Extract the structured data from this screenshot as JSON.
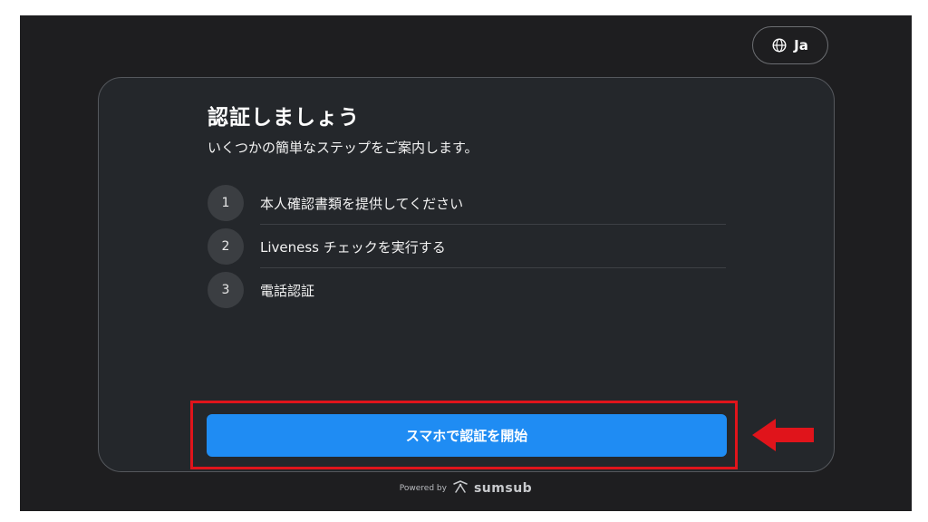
{
  "header": {
    "language_label": "Ja",
    "language_icon": "globe-icon"
  },
  "card": {
    "title": "認証しましょう",
    "subtitle": "いくつかの簡単なステップをご案内します。",
    "steps": [
      {
        "number": "1",
        "label": "本人確認書類を提供してください"
      },
      {
        "number": "2",
        "label": "Liveness チェックを実行する"
      },
      {
        "number": "3",
        "label": "電話認証"
      }
    ],
    "cta_label": "スマホで認証を開始"
  },
  "annotation": {
    "highlight_color": "#e0141b",
    "arrow_icon": "left-arrow-icon"
  },
  "footer": {
    "powered_by": "Powered by",
    "brand": "sumsub",
    "brand_icon": "sumsub-logo-icon"
  },
  "colors": {
    "background": "#1e1e20",
    "card": "#24272b",
    "accent": "#1f8cf3"
  }
}
